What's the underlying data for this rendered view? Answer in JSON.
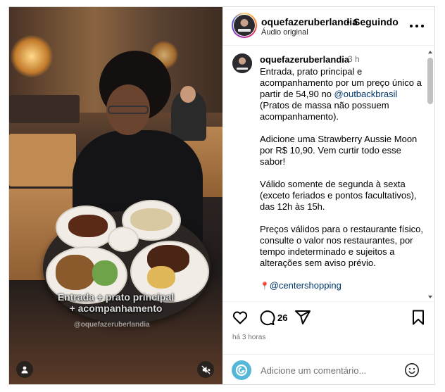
{
  "post": {
    "username": "oquefazeruberlandia",
    "separator": "•",
    "follow_status": "Seguindo",
    "audio_label": "Áudio original"
  },
  "media": {
    "overlay_line1": "Entrada + prato principal",
    "overlay_line2": "+ acompanhamento",
    "watermark": "@oquefazeruberlandia",
    "user_tag_icon": "person-icon",
    "mute_icon": "muted-speaker-icon"
  },
  "caption": {
    "username": "oquefazeruberlandia",
    "time": "3 h",
    "p1_text": "Entrada, prato principal e acompanhamento por um preço único a partir de 54,90 no ",
    "p1_mention": "@outbackbrasil",
    "p1_after": " (Pratos de massa não possuem acompanhamento).",
    "p2": "Adicione uma Strawberry Aussie Moon por R$ 10,90. Vem curtir todo esse sabor!",
    "p3": "Válido somente de segunda à sexta (exceto feriados e pontos facultativos), das 12h às 15h.",
    "p4": "Preços válidos para o restaurante físico, consulte o valor nos restaurantes, por tempo indeterminado e sujeitos a alterações sem aviso prévio.",
    "location_pin": "📍",
    "location_mention": "@centershopping"
  },
  "actions": {
    "like_icon": "heart-icon",
    "comment_icon": "comment-icon",
    "comment_count": "26",
    "share_icon": "share-icon",
    "save_icon": "bookmark-icon",
    "time_ago": "há 3 horas"
  },
  "comment_box": {
    "placeholder": "Adicione um comentário...",
    "emoji_icon": "emoji-icon"
  },
  "colors": {
    "link": "#00376b",
    "muted": "#737373",
    "border": "#dbdbdb"
  }
}
